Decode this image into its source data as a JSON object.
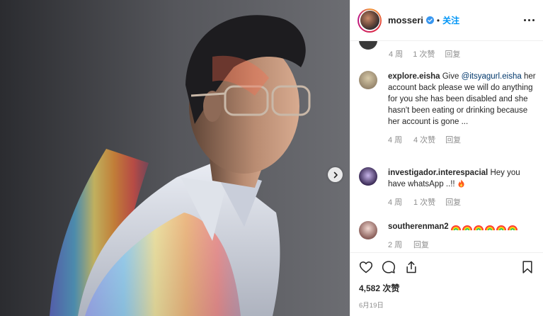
{
  "post": {
    "author": "mosseri",
    "verified": true,
    "separator": "•",
    "follow_label": "关注",
    "more_icon": "more-options-icon"
  },
  "photo": {
    "next_icon": "chevron-right-icon"
  },
  "comments": {
    "previous": {
      "time": "4 周",
      "likes": "1 次赞",
      "reply": "回复"
    },
    "items": [
      {
        "user": "explore.eisha",
        "prefix": "Give ",
        "mention": "@itsyagurl.eisha",
        "text": " her account back please we will do anything for you she has been disabled and she hasn't been eating or drinking because her account is gone ...",
        "time": "4 周",
        "likes": "4 次赞",
        "reply": "回复"
      },
      {
        "user": "investigador.interespacial",
        "text": "Hey you have whatsApp ..!! ",
        "emoji": "fire",
        "time": "4 周",
        "likes": "1 次赞",
        "reply": "回复"
      },
      {
        "user": "southerenman2",
        "emoji": "rainbow x6",
        "time": "2 周",
        "reply": "回复"
      }
    ]
  },
  "actions": {
    "like_icon": "heart-icon",
    "comment_icon": "comment-icon",
    "share_icon": "share-icon",
    "save_icon": "bookmark-icon"
  },
  "likes_text": "4,582 次赞",
  "date_text": "6月19日"
}
